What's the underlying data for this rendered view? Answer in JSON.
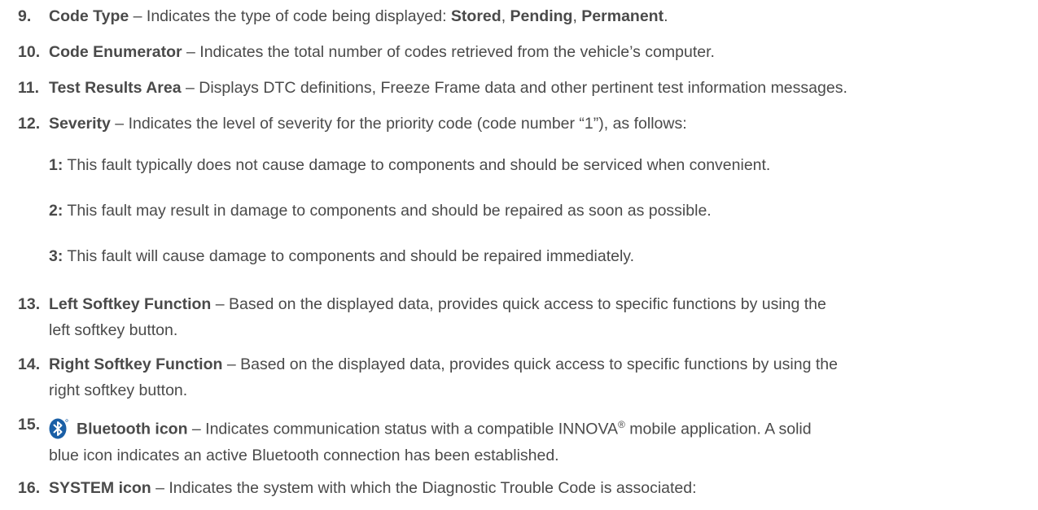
{
  "items": [
    {
      "num": "9.",
      "term": "Code Type",
      "pre": " – Indicates the type of code being displayed: ",
      "opt1": "Stored",
      "sep1": ", ",
      "opt2": "Pending",
      "sep2": ", ",
      "opt3": "Permanent",
      "end": "."
    },
    {
      "num": "10.",
      "term": "Code Enumerator",
      "desc": " – Indicates the total number of codes retrieved from the vehicle’s computer."
    },
    {
      "num": "11.",
      "term": "Test Results Area",
      "desc": " – Displays DTC definitions, Freeze Frame data and other pertinent test information messages."
    },
    {
      "num": "12.",
      "term": "Severity",
      "desc": " – Indicates the level of severity for the priority code (code number “1”), as follows:"
    },
    {
      "num": "13.",
      "term": "Left Softkey Function",
      "line1": " – Based on the displayed data, provides quick access to specific functions by using the",
      "line2": "left softkey button."
    },
    {
      "num": "14.",
      "term": "Right Softkey Function",
      "line1": " – Based on the displayed data, provides quick access to specific functions by using the",
      "line2": "right softkey button."
    },
    {
      "num": "15.",
      "icon": "bluetooth-icon",
      "term": "Bluetooth icon",
      "line1a": " – Indicates communication status with a compatible INNOVA",
      "reg": "®",
      "line1b": " mobile application. A solid",
      "line2": "blue icon indicates an active Bluetooth connection has been established."
    },
    {
      "num": "16.",
      "term": "SYSTEM icon",
      "desc": " – Indicates the system with which the Diagnostic Trouble Code is associated:"
    }
  ],
  "severity_levels": [
    {
      "level": "1:",
      "text": " This fault typically does not cause damage to components and should be serviced when convenient."
    },
    {
      "level": "2:",
      "text": " This fault may result in damage to components and should be repaired as soon as possible."
    },
    {
      "level": "3:",
      "text": " This fault will cause damage to components and should be repaired immediately."
    }
  ],
  "colors": {
    "text": "#4a4a4a",
    "bluetooth": "#1a5fa6"
  }
}
